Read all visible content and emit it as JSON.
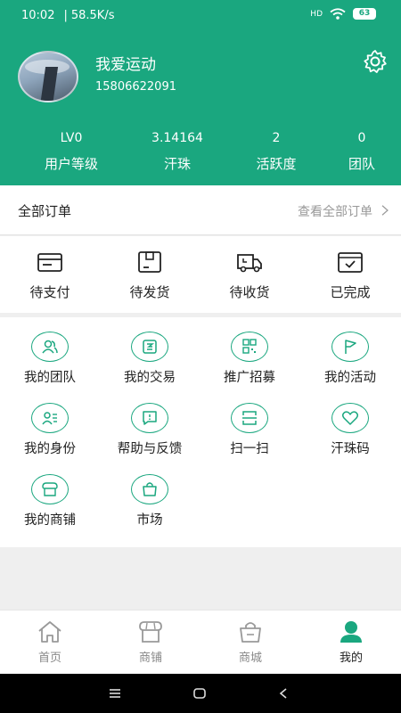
{
  "status": {
    "time": "10:02",
    "speed": "58.5K/s",
    "network": "HD",
    "battery": "63"
  },
  "profile": {
    "name": "我爱运动",
    "phone": "15806622091"
  },
  "stats": [
    {
      "value": "LV0",
      "label": "用户等级"
    },
    {
      "value": "3.14164",
      "label": "汗珠"
    },
    {
      "value": "2",
      "label": "活跃度"
    },
    {
      "value": "0",
      "label": "团队"
    }
  ],
  "orders": {
    "title": "全部订单",
    "more": "查看全部订单",
    "items": [
      {
        "label": "待支付",
        "icon": "wallet-icon"
      },
      {
        "label": "待发货",
        "icon": "package-icon"
      },
      {
        "label": "待收货",
        "icon": "truck-icon"
      },
      {
        "label": "已完成",
        "icon": "check-box-icon"
      }
    ]
  },
  "services": [
    {
      "label": "我的团队",
      "icon": "team-icon"
    },
    {
      "label": "我的交易",
      "icon": "trade-icon"
    },
    {
      "label": "推广招募",
      "icon": "qrcode-icon"
    },
    {
      "label": "我的活动",
      "icon": "flag-icon"
    },
    {
      "label": "我的身份",
      "icon": "id-icon"
    },
    {
      "label": "帮助与反馈",
      "icon": "feedback-icon"
    },
    {
      "label": "扫一扫",
      "icon": "scan-icon"
    },
    {
      "label": "汗珠码",
      "icon": "heart-icon"
    },
    {
      "label": "我的商铺",
      "icon": "shop-icon"
    },
    {
      "label": "市场",
      "icon": "bag-icon"
    }
  ],
  "tabs": [
    {
      "label": "首页",
      "icon": "home-icon"
    },
    {
      "label": "商铺",
      "icon": "store-icon"
    },
    {
      "label": "商城",
      "icon": "mall-icon"
    },
    {
      "label": "我的",
      "icon": "user-icon"
    }
  ],
  "colors": {
    "brand": "#1aa77f",
    "background": "#efefef"
  }
}
